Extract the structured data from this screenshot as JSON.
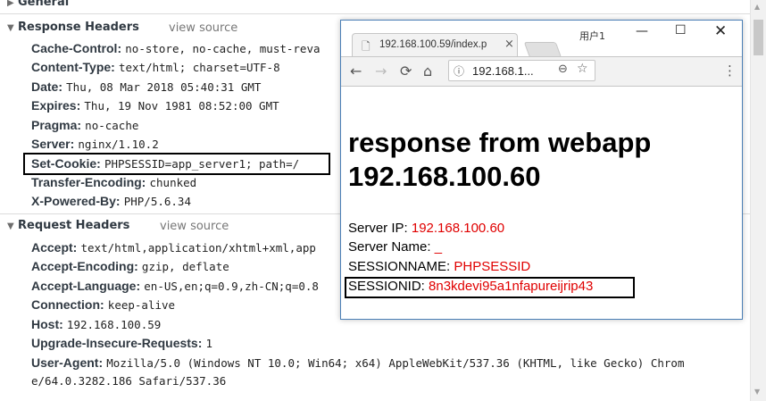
{
  "devtools": {
    "general": {
      "label": "General"
    },
    "response_headers": {
      "label": "Response Headers",
      "view_source": "view source",
      "items": [
        {
          "name": "Cache-Control:",
          "value": "no-store, no-cache, must-reva"
        },
        {
          "name": "Content-Type:",
          "value": "text/html; charset=UTF-8"
        },
        {
          "name": "Date:",
          "value": "Thu, 08 Mar 2018 05:40:31 GMT"
        },
        {
          "name": "Expires:",
          "value": "Thu, 19 Nov 1981 08:52:00 GMT"
        },
        {
          "name": "Pragma:",
          "value": "no-cache"
        },
        {
          "name": "Server:",
          "value": "nginx/1.10.2"
        },
        {
          "name": "Set-Cookie:",
          "value": "PHPSESSID=app_server1; path=/"
        },
        {
          "name": "Transfer-Encoding:",
          "value": "chunked"
        },
        {
          "name": "X-Powered-By:",
          "value": "PHP/5.6.34"
        }
      ]
    },
    "request_headers": {
      "label": "Request Headers",
      "view_source": "view source",
      "items": [
        {
          "name": "Accept:",
          "value": "text/html,application/xhtml+xml,app"
        },
        {
          "name": "Accept-Encoding:",
          "value": "gzip, deflate"
        },
        {
          "name": "Accept-Language:",
          "value": "en-US,en;q=0.9,zh-CN;q=0.8"
        },
        {
          "name": "Connection:",
          "value": "keep-alive"
        },
        {
          "name": "Host:",
          "value": "192.168.100.59"
        },
        {
          "name": "Upgrade-Insecure-Requests:",
          "value": "1"
        },
        {
          "name": "User-Agent:",
          "value": "Mozilla/5.0 (Windows NT 10.0; Win64; x64) AppleWebKit/537.36 (KHTML, like Gecko) Chrom",
          "value_line2": "e/64.0.3282.186 Safari/537.36"
        }
      ]
    }
  },
  "browser": {
    "user_label": "用户1",
    "tab_title": "192.168.100.59/index.p",
    "url": "192.168.1...",
    "heading_line1": "response from webapp",
    "heading_line2": "192.168.100.60",
    "info": [
      {
        "label": "Server IP: ",
        "value": "192.168.100.60"
      },
      {
        "label": "Server Name: ",
        "value": "_"
      },
      {
        "label": "SESSIONNAME: ",
        "value": "PHPSESSID"
      },
      {
        "label": "SESSIONID: ",
        "value": "8n3kdevi95a1nfapureijrip43"
      }
    ],
    "value_color": "#e00000",
    "highlight_color": "#000000"
  },
  "icons": [
    "triangle-right-icon",
    "triangle-down-icon",
    "page-icon",
    "close-icon",
    "minimize-icon",
    "maximize-icon",
    "back-icon",
    "forward-icon",
    "reload-icon",
    "home-icon",
    "info-icon",
    "zoom-icon",
    "star-icon",
    "menu-icon"
  ]
}
